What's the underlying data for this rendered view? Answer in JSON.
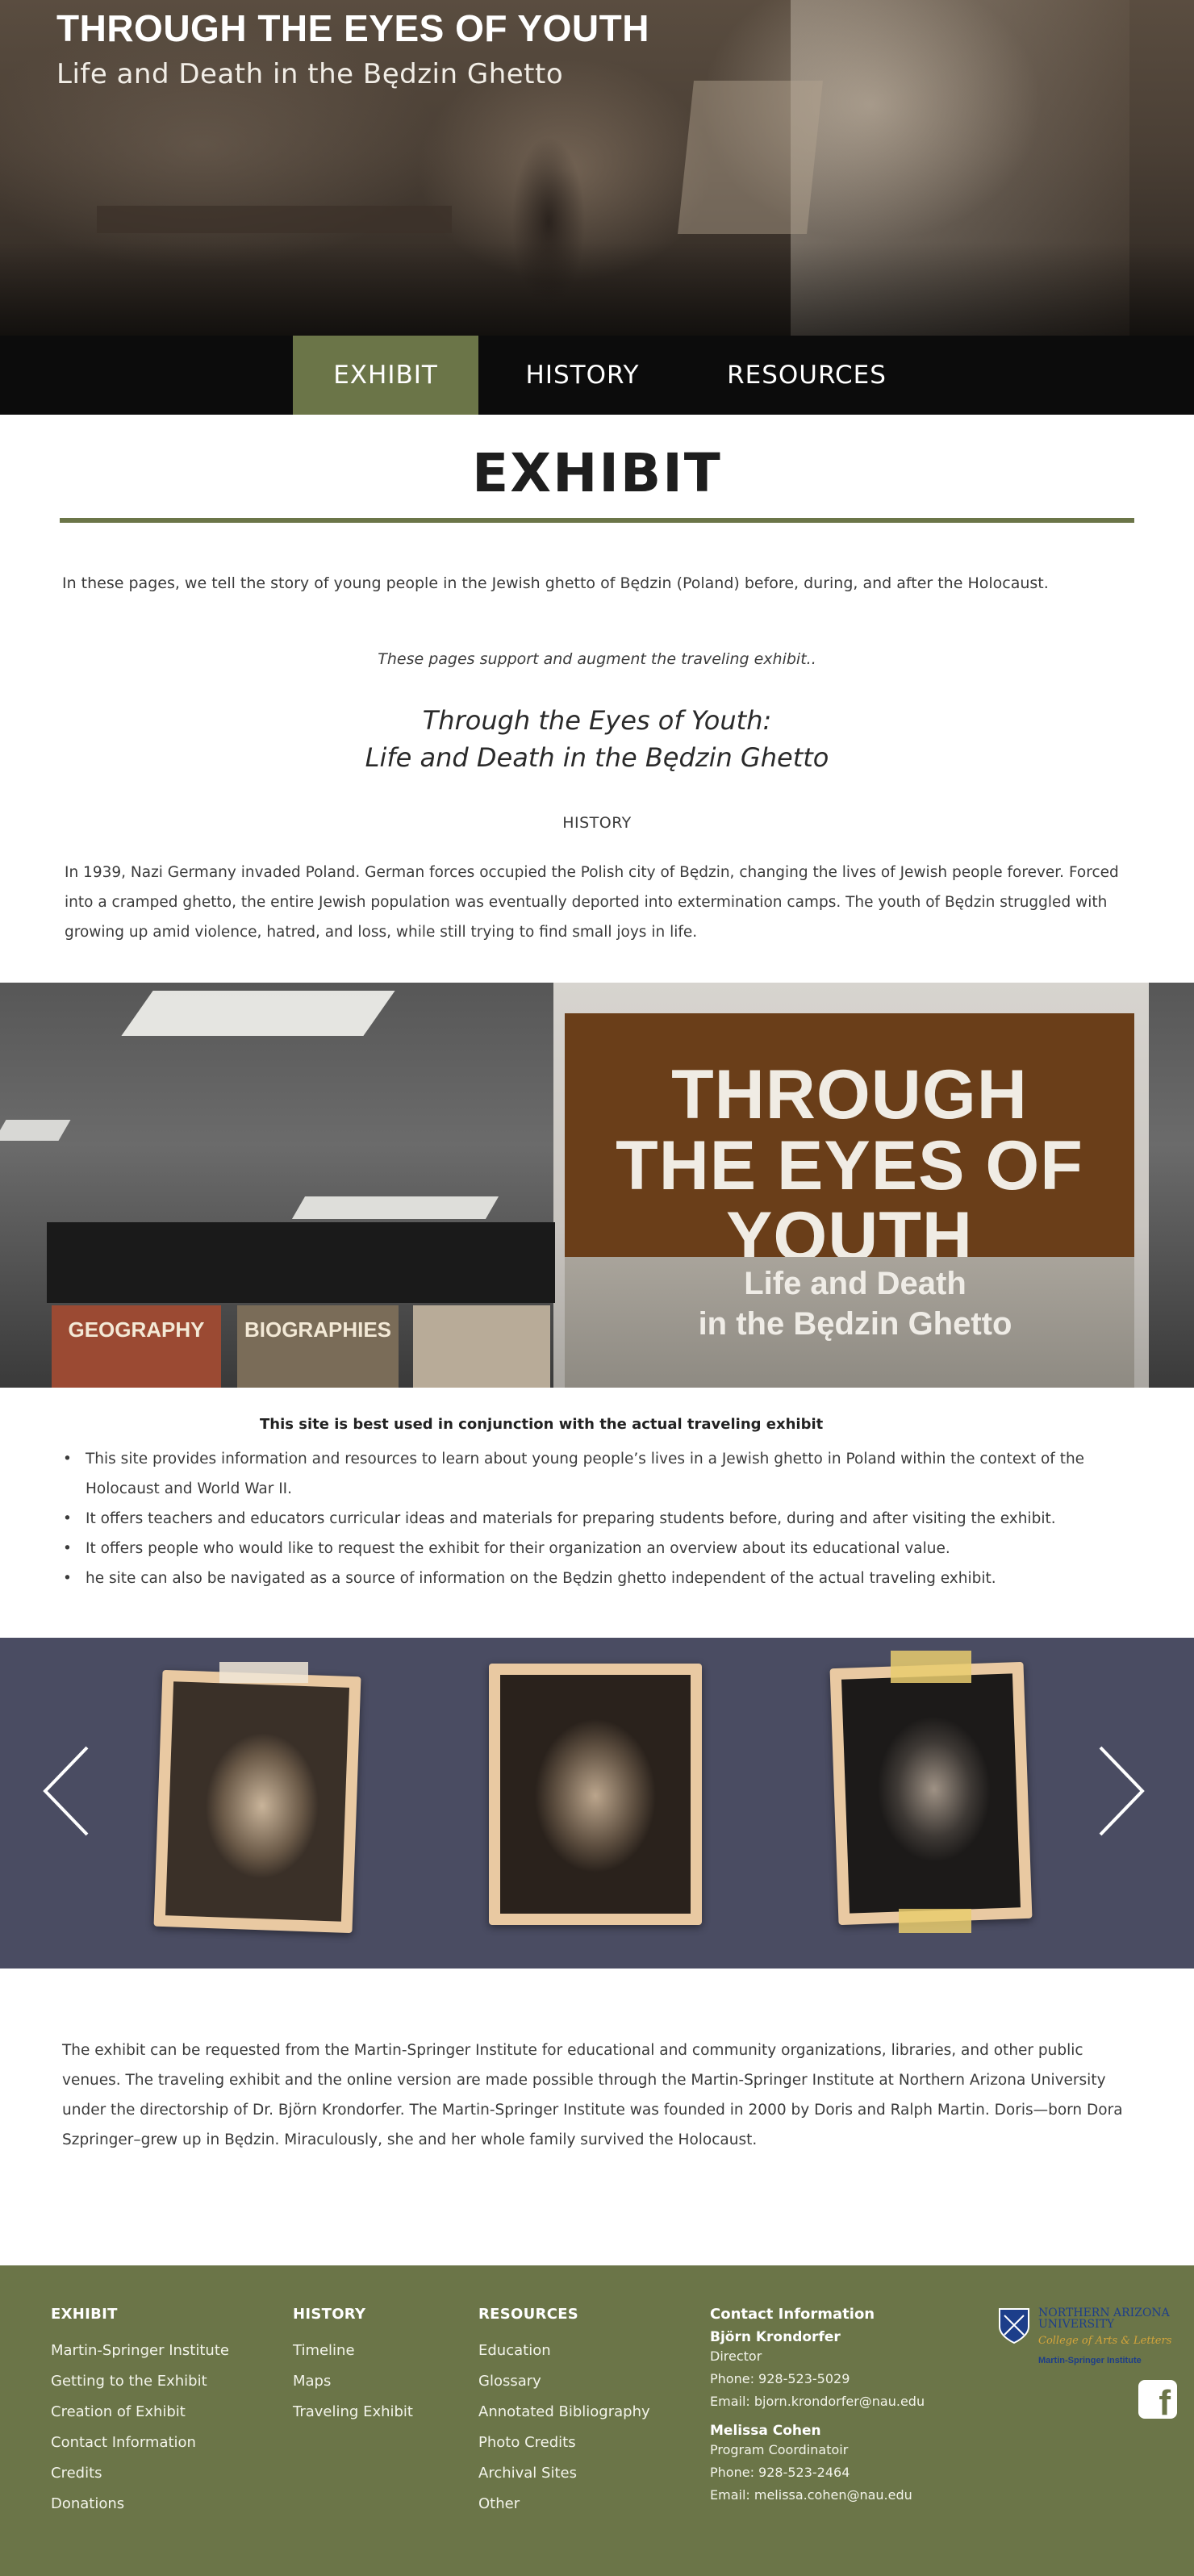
{
  "hero": {
    "title": "THROUGH THE EYES OF YOUTH",
    "subtitle": "Life and Death in the Będzin Ghetto"
  },
  "nav": {
    "items": [
      {
        "label": "EXHIBIT",
        "active": true
      },
      {
        "label": "HISTORY",
        "active": false
      },
      {
        "label": "RESOURCES",
        "active": false
      }
    ]
  },
  "main": {
    "page_title": "EXHIBIT",
    "intro": "In these pages, we tell the story of young people in the Jewish ghetto of Będzin (Poland) before, during, and after the Holocaust.",
    "support_note": "These pages support and augment the traveling exhibit..",
    "exhibit_name_line1": "Through the Eyes of Youth:",
    "exhibit_name_line2": "Life and Death in the Będzin Ghetto",
    "history_label": "HISTORY",
    "history_text": "In 1939, Nazi Germany invaded Poland. German forces occupied the Polish city of Będzin, changing the lives of Jewish people forever. Forced into a cramped ghetto, the entire Jewish population was eventually deported into extermination camps. The youth of Będzin struggled with growing up amid violence, hatred, and loss, while still trying to find small joys in life."
  },
  "photo_band": {
    "banner_big_line1": "THROUGH",
    "banner_big_line2": "THE EYES OF YOUTH",
    "banner_small_line1": "Life and Death",
    "banner_small_line2": "in the Będzin Ghetto",
    "panel_geography": "GEOGRAPHY",
    "panel_biographies": "BIOGRAPHIES"
  },
  "features": {
    "heading": "This site is best used in conjunction with the actual traveling exhibit",
    "bullet_glyph": "•",
    "items": [
      "This site provides information and resources to learn about young people’s lives in a Jewish ghetto in Poland within the context of the Holocaust and World War II.",
      "It offers teachers and educators curricular ideas and materials for preparing students before, during and after visiting the    exhibit.",
      "It offers people who would like to request the exhibit for their organization an overview about its educational value.",
      "he site can also be navigated as a source of information on the Będzin ghetto independent of the actual traveling exhibit."
    ]
  },
  "carousel": {
    "background": "#4a4c62",
    "prev_icon": "chevron-left-icon",
    "next_icon": "chevron-right-icon"
  },
  "about": {
    "text": "The exhibit can be requested from the Martin-Springer Institute for educational and community organizations, libraries, and other public venues. The traveling exhibit and the online version are made possible through the Martin-Springer Institute at Northern Arizona University under the directorship of Dr. Björn Krondorfer. The Martin-Springer Institute was founded in 2000 by Doris and Ralph Martin. Doris—born Dora Szpringer–grew up in Będzin. Miraculously, she and her whole family survived the Holocaust."
  },
  "footer": {
    "background": "#6b7548",
    "exhibit": {
      "heading": "EXHIBIT",
      "links": [
        "Martin-Springer Institute",
        "Getting to the Exhibit",
        "Creation of Exhibit",
        "Contact Information",
        "Credits",
        "Donations"
      ]
    },
    "history": {
      "heading": "HISTORY",
      "links": [
        "Timeline",
        "Maps",
        "Traveling Exhibit"
      ]
    },
    "resources": {
      "heading": "RESOURCES",
      "links": [
        "Education",
        "Glossary",
        "Annotated Bibliography",
        "Photo Credits",
        "Archival Sites",
        "Other"
      ]
    },
    "contact": {
      "heading": "Contact Information",
      "people": [
        {
          "name": "Björn Krondorfer",
          "role": "Director",
          "phone": "Phone: 928-523-5029",
          "email": "Email: bjorn.krondorfer@nau.edu"
        },
        {
          "name": "Melissa Cohen",
          "role": "Program Coordinatoir",
          "phone": "Phone: 928-523-2464",
          "email": "Email: melissa.cohen@nau.edu"
        }
      ]
    },
    "logo": {
      "line1": "NORTHERN ARIZONA",
      "line2": "UNIVERSITY",
      "college": "College of Arts & Letters",
      "institute": "Martin-Springer Institute"
    },
    "social_icon": "facebook-icon",
    "social_glyph": "f"
  }
}
